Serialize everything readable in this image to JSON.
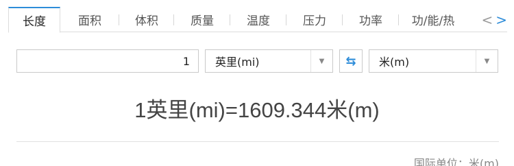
{
  "tabs": [
    {
      "label": "长度",
      "active": true
    },
    {
      "label": "面积",
      "active": false
    },
    {
      "label": "体积",
      "active": false
    },
    {
      "label": "质量",
      "active": false
    },
    {
      "label": "温度",
      "active": false
    },
    {
      "label": "压力",
      "active": false
    },
    {
      "label": "功率",
      "active": false
    },
    {
      "label": "功/能/热",
      "active": false
    }
  ],
  "nav": {
    "prev": "<",
    "next": ">"
  },
  "converter": {
    "input_value": "1",
    "from_unit": "英里(mi)",
    "to_unit": "米(m)",
    "swap_icon": "⇆"
  },
  "result": "1英里(mi)=1609.344米(m)",
  "si_unit_note": "国际单位：米(m)",
  "colors": {
    "accent": "#2d8cd9",
    "border": "#c9c9c9",
    "text": "#444444"
  }
}
